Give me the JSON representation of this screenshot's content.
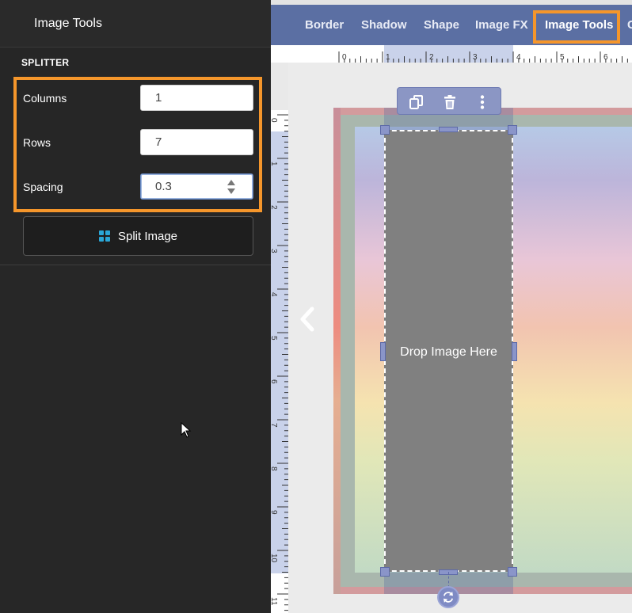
{
  "panel": {
    "title": "Image Tools",
    "section_title": "SPLITTER",
    "fields": {
      "columns": {
        "label": "Columns",
        "value": "1"
      },
      "rows": {
        "label": "Rows",
        "value": "7"
      },
      "spacing": {
        "label": "Spacing",
        "value": "0.3"
      }
    },
    "split_button": {
      "label": "Split Image",
      "icon": "grid-icon"
    }
  },
  "toolbar": {
    "tabs": [
      "Border",
      "Shadow",
      "Shape",
      "Image FX",
      "Image Tools",
      "C"
    ],
    "active_tab": "Image Tools"
  },
  "rulers": {
    "horizontal": [
      "0",
      "1",
      "2",
      "3",
      "4",
      "5",
      "6"
    ],
    "vertical": [
      "0",
      "1",
      "2",
      "3",
      "4",
      "5",
      "6",
      "7",
      "8",
      "9",
      "10",
      "11"
    ]
  },
  "canvas": {
    "placeholder_text": "Drop Image Here",
    "element_tools": [
      "duplicate-icon",
      "trash-icon",
      "more-vertical-icon"
    ]
  },
  "colors": {
    "accent_highlight": "#f5962b",
    "toolbar_bg": "#5b6fa3",
    "panel_bg": "#262626",
    "split_icon": "#2aa7d8"
  }
}
